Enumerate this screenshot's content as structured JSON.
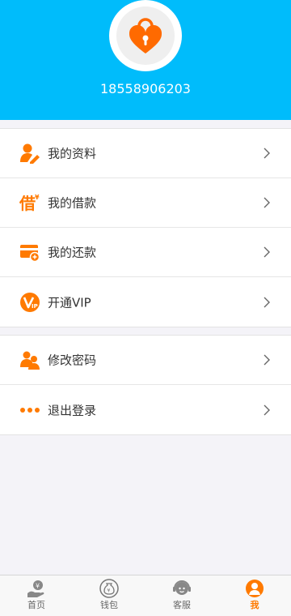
{
  "profile": {
    "phone": "18558906203",
    "avatar_icon": "heart-lock-icon"
  },
  "menu_primary": [
    {
      "label": "我的资料",
      "icon": "profile-edit-icon"
    },
    {
      "label": "我的借款",
      "icon": "borrow-icon"
    },
    {
      "label": "我的还款",
      "icon": "repay-card-icon"
    },
    {
      "label": "开通VIP",
      "icon": "vip-icon"
    }
  ],
  "menu_secondary": [
    {
      "label": "修改密码",
      "icon": "users-icon"
    },
    {
      "label": "退出登录",
      "icon": "more-dots-icon"
    }
  ],
  "tabbar": [
    {
      "label": "首页",
      "icon": "home-hand-coin-icon"
    },
    {
      "label": "钱包",
      "icon": "wallet-bag-icon"
    },
    {
      "label": "客服",
      "icon": "service-icon"
    },
    {
      "label": "我",
      "icon": "me-icon",
      "active": true
    }
  ],
  "colors": {
    "header": "#00bcfb",
    "accent": "#ff7a00",
    "background": "#f4f3f8"
  }
}
